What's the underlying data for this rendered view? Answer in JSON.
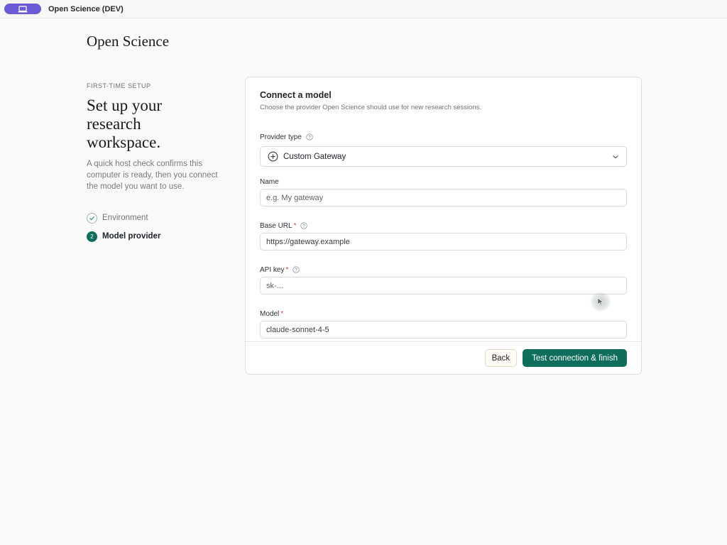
{
  "titlebar": {
    "title": "Open Science (DEV)"
  },
  "brand": "Open Science",
  "intro": {
    "eyebrow": "FIRST-TIME SETUP",
    "headline_lines": [
      "Set up your",
      "research",
      "workspace."
    ],
    "description": "A quick host check confirms this computer is ready, then you connect the model you want to use."
  },
  "steps": [
    {
      "label": "Environment",
      "state": "done"
    },
    {
      "number": "2",
      "label": "Model provider",
      "state": "current"
    }
  ],
  "card": {
    "title": "Connect a model",
    "subtitle": "Choose the provider Open Science should use for new research sessions.",
    "provider": {
      "label": "Provider type",
      "value": "Custom Gateway"
    },
    "name": {
      "label": "Name",
      "placeholder": "e.g. My gateway"
    },
    "base_url": {
      "label": "Base URL",
      "required": "*",
      "value": "https://gateway.example"
    },
    "api_key": {
      "label": "API key",
      "required": "*",
      "placeholder": "sk-..."
    },
    "model": {
      "label": "Model",
      "required": "*",
      "value": "claude-sonnet-4-5"
    },
    "back_label": "Back",
    "submit_label": "Test connection & finish"
  },
  "colors": {
    "accent": "#0f6e5b",
    "titlebar_pill": "#6b5bd6",
    "required": "#d14343"
  }
}
